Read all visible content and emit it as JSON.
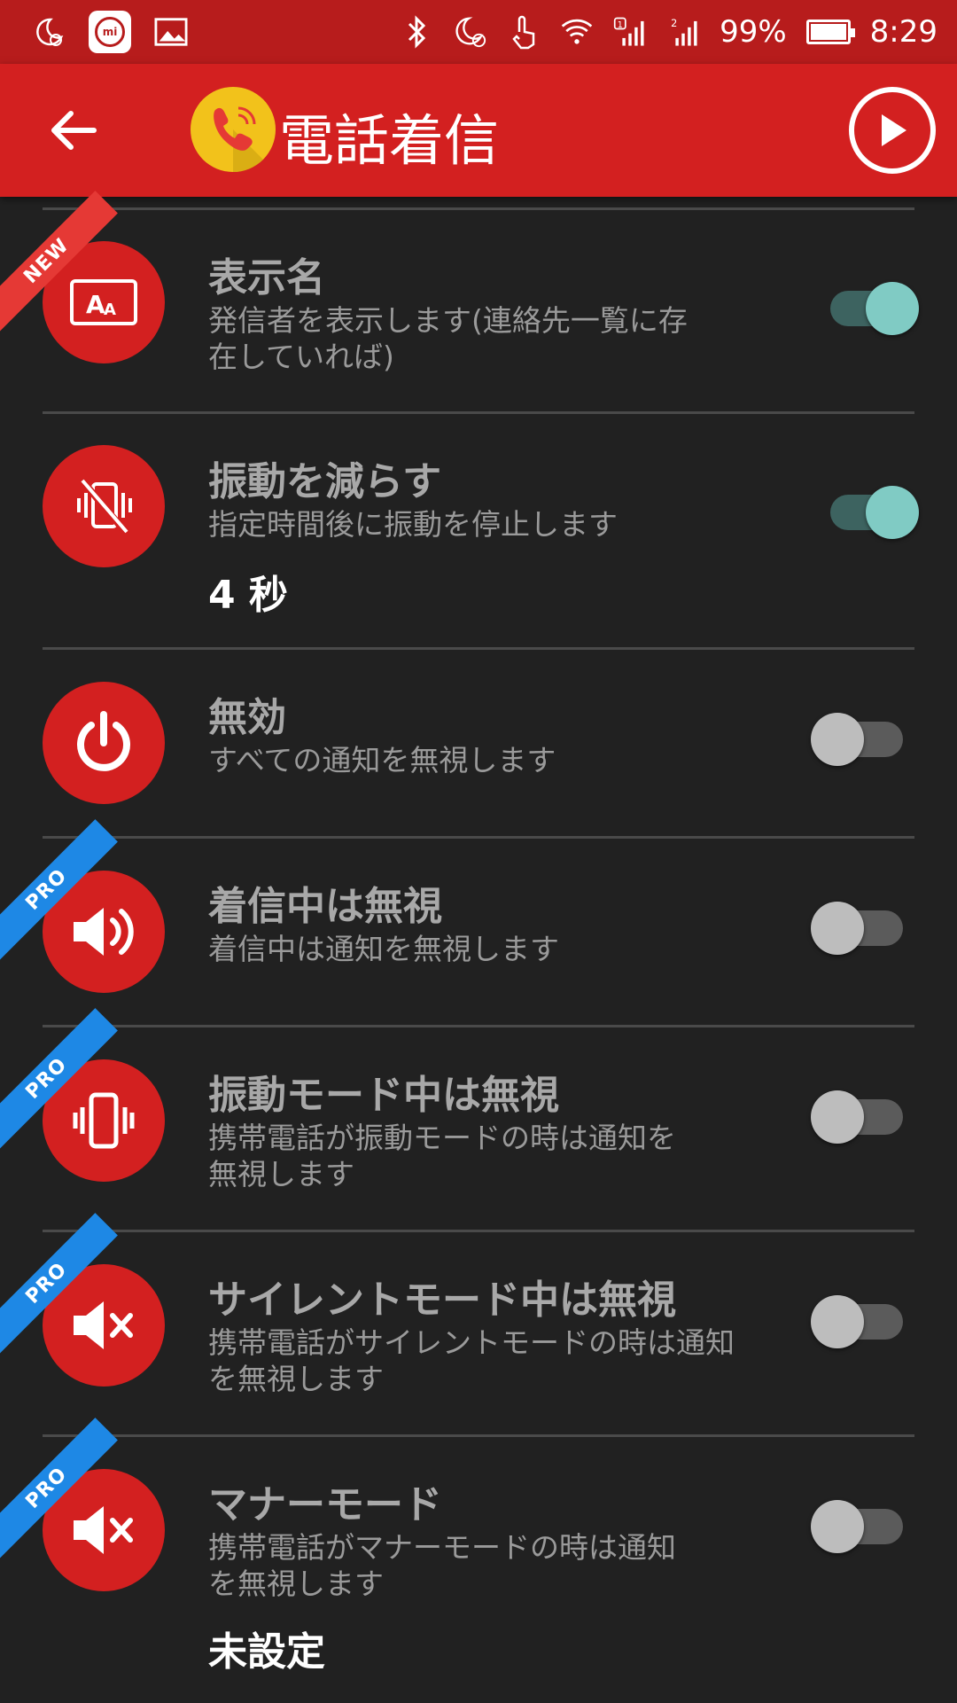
{
  "status_bar": {
    "battery": "99%",
    "time": "8:29",
    "battery_level": 0.99,
    "sim1": "1",
    "sim2": "2"
  },
  "app_bar": {
    "title": "電話着信"
  },
  "items": [
    {
      "title": "表示名",
      "desc": "発信者を表示します(連絡先一覧に存在していれば)",
      "badge": "NEW",
      "toggle": true,
      "icon": "display-name-icon"
    },
    {
      "title": "振動を減らす",
      "desc": "指定時間後に振動を停止します",
      "value": "4 秒",
      "toggle": true,
      "icon": "vibration-off-icon"
    },
    {
      "title": "無効",
      "desc": "すべての通知を無視します",
      "toggle": false,
      "icon": "power-icon"
    },
    {
      "title": "着信中は無視",
      "desc": "着信中は通知を無視します",
      "badge": "PRO",
      "toggle": false,
      "icon": "speaker-icon"
    },
    {
      "title": "振動モード中は無視",
      "desc": "携帯電話が振動モードの時は通知を無視します",
      "badge": "PRO",
      "toggle": false,
      "icon": "vibrate-phone-icon"
    },
    {
      "title": "サイレントモード中は無視",
      "desc": "携帯電話がサイレントモードの時は通知を無視します",
      "badge": "PRO",
      "toggle": false,
      "icon": "mute-icon"
    },
    {
      "title": "マナーモード",
      "desc": "携帯電話がマナーモードの時は通知を無視します",
      "value": "未設定",
      "badge": "PRO",
      "toggle": false,
      "icon": "mute-icon"
    }
  ],
  "colors": {
    "app_bar": "#d32020",
    "status_bar": "#b71c1c",
    "toggle_on": "#80cbc4",
    "badge_new": "#e53935",
    "badge_pro": "#1e88e5"
  }
}
